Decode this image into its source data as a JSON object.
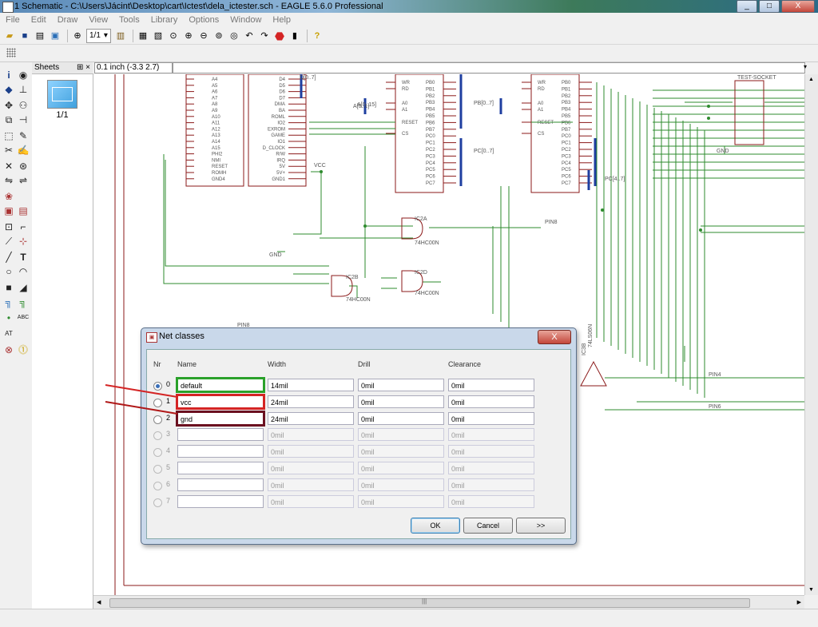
{
  "window": {
    "title": "1 Schematic - C:\\Users\\Jácint\\Desktop\\cart\\Ictest\\dela_ictester.sch - EAGLE 5.6.0 Professional",
    "min": "_",
    "max": "□",
    "close": "X"
  },
  "menu": [
    "File",
    "Edit",
    "Draw",
    "View",
    "Tools",
    "Library",
    "Options",
    "Window",
    "Help"
  ],
  "toolbar": {
    "sheet_select": "1/1",
    "dropdown_glyph": "▾"
  },
  "sheets_panel": {
    "title": "Sheets",
    "controls": "⊞ ×",
    "sheet_label": "1/1"
  },
  "command": {
    "coordinate": "0.1 inch (-3.3 2.7)",
    "value": ""
  },
  "schematic": {
    "labels": [
      "D[0..7]",
      "A[0..15]",
      "PB[0..7]",
      "PC[0..7]",
      "A[0..1]",
      "PC[4..7]",
      "VCC",
      "GND",
      "GND",
      "TEST-SOCKET",
      "IC2A",
      "IC2B",
      "IC2D",
      "IC3B",
      "74HC00N",
      "74HC00N",
      "74HC00N",
      "74LS06N",
      "PIN8",
      "PIN8",
      "PIN4",
      "PIN6"
    ],
    "left_pins": [
      "A4",
      "A5",
      "A6",
      "A7",
      "A8",
      "A9",
      "A10",
      "A11",
      "A12",
      "A13",
      "A14",
      "A15",
      "PHI2",
      "NMI",
      "RESET",
      "ROMH",
      "GND4"
    ],
    "mid_pins": [
      "D4",
      "D5",
      "D6",
      "D7",
      "DMA",
      "BA",
      "ROML",
      "IO2",
      "EXROM",
      "GAME",
      "IO1",
      "D_CLOCK",
      "R/W",
      "IRQ",
      "5V",
      "5V+",
      "GND1"
    ],
    "chip_pins_left": [
      "WR",
      "RD",
      "A0",
      "A1",
      "RESET",
      "CS"
    ],
    "chip_pins_right": [
      "PB0",
      "PB1",
      "PB2",
      "PB3",
      "PB4",
      "PB5",
      "PB6",
      "PB7",
      "PC0",
      "PC1",
      "PC2",
      "PC3",
      "PC4",
      "PC5",
      "PC6",
      "PC7"
    ]
  },
  "dialog": {
    "title": "Net classes",
    "close": "X",
    "headers": {
      "nr": "Nr",
      "name": "Name",
      "width": "Width",
      "drill": "Drill",
      "clearance": "Clearance"
    },
    "rows": [
      {
        "nr": "0",
        "name": "default",
        "width": "14mil",
        "drill": "0mil",
        "clearance": "0mil",
        "enabled": true,
        "selected": true
      },
      {
        "nr": "1",
        "name": "vcc",
        "width": "24mil",
        "drill": "0mil",
        "clearance": "0mil",
        "enabled": true,
        "selected": false
      },
      {
        "nr": "2",
        "name": "gnd",
        "width": "24mil",
        "drill": "0mil",
        "clearance": "0mil",
        "enabled": true,
        "selected": false
      },
      {
        "nr": "3",
        "name": "",
        "width": "0mil",
        "drill": "0mil",
        "clearance": "0mil",
        "enabled": false,
        "selected": false
      },
      {
        "nr": "4",
        "name": "",
        "width": "0mil",
        "drill": "0mil",
        "clearance": "0mil",
        "enabled": false,
        "selected": false
      },
      {
        "nr": "5",
        "name": "",
        "width": "0mil",
        "drill": "0mil",
        "clearance": "0mil",
        "enabled": false,
        "selected": false
      },
      {
        "nr": "6",
        "name": "",
        "width": "0mil",
        "drill": "0mil",
        "clearance": "0mil",
        "enabled": false,
        "selected": false
      },
      {
        "nr": "7",
        "name": "",
        "width": "0mil",
        "drill": "0mil",
        "clearance": "0mil",
        "enabled": false,
        "selected": false
      }
    ],
    "buttons": {
      "ok": "OK",
      "cancel": "Cancel",
      "more": ">>"
    }
  },
  "colors": {
    "wire": "#2e8b2e",
    "part": "#8b1a1a",
    "bus": "#1f3fa0",
    "highlight_default": "#2aa12a",
    "highlight_vcc": "#d42424",
    "highlight_gnd": "#6b1020"
  }
}
